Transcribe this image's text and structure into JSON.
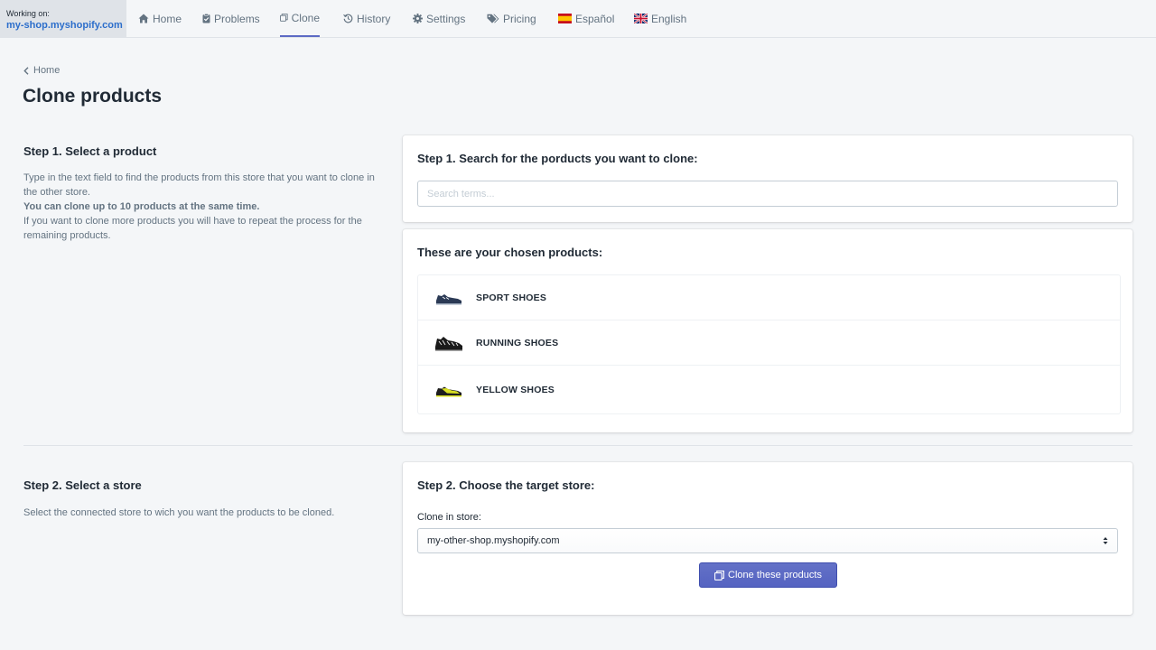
{
  "nav": {
    "working_label": "Working on:",
    "shop": "my-shop.myshopify.com",
    "items": [
      {
        "label": "Home",
        "icon": "home-icon"
      },
      {
        "label": "Problems",
        "icon": "clipboard-check-icon"
      },
      {
        "label": "Clone",
        "icon": "clone-icon",
        "active": true
      },
      {
        "label": "History",
        "icon": "history-icon"
      },
      {
        "label": "Settings",
        "icon": "gear-icon"
      },
      {
        "label": "Pricing",
        "icon": "tags-icon"
      },
      {
        "label": "Español",
        "icon": "spain-flag-icon"
      },
      {
        "label": "English",
        "icon": "uk-flag-icon"
      }
    ]
  },
  "breadcrumb": "Home",
  "page_title": "Clone products",
  "step1": {
    "side_title": "Step 1. Select a product",
    "desc1": "Type in the text field to find the products from this store that you want to clone in the other store.",
    "desc_bold": "You can clone up to 10 products at the same time.",
    "desc2": "If you want to clone more products you will have to repeat the process for the remaining products.",
    "search_title": "Step 1. Search for the porducts you want to clone:",
    "search_placeholder": "Search terms...",
    "search_value": "",
    "chosen_title": "These are your chosen products:",
    "products": [
      {
        "name": "SPORT SHOES",
        "color": "#2b3a55"
      },
      {
        "name": "RUNNING SHOES",
        "color": "#1a1a1a"
      },
      {
        "name": "YELLOW SHOES",
        "color": "#d9e021"
      }
    ]
  },
  "step2": {
    "side_title": "Step 2. Select a store",
    "desc": "Select the connected store to wich you want the products to be cloned.",
    "card_title": "Step 2. Choose the target store:",
    "field_label": "Clone in store:",
    "selected_store": "my-other-shop.myshopify.com",
    "button_label": "Clone these products"
  },
  "colors": {
    "accent": "#5c6ac4",
    "shop_link": "#2c6ecb",
    "background": "#f4f6f8"
  }
}
